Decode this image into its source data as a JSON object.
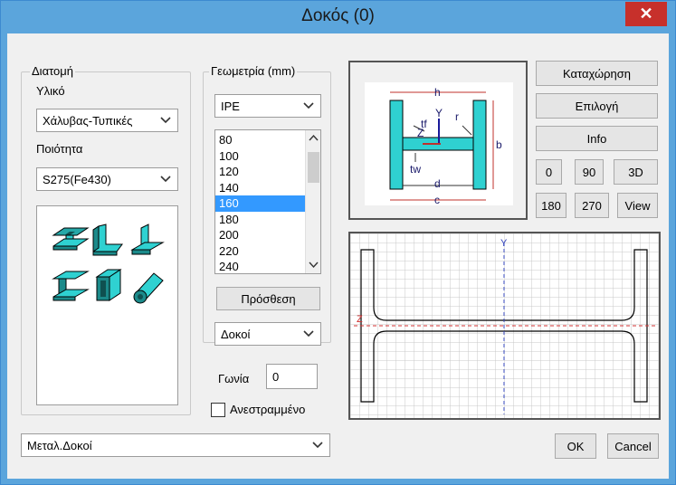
{
  "window": {
    "title": "Δοκός (0)"
  },
  "section": {
    "legend": "Διατομή",
    "material_label": "Υλικό",
    "material_value": "Χάλυβας-Τυπικές",
    "quality_label": "Ποιότητα",
    "quality_value": "S275(Fe430)"
  },
  "geometry": {
    "legend": "Γεωμετρία (mm)",
    "profile_type": "IPE",
    "sizes": [
      "80",
      "100",
      "120",
      "140",
      "160",
      "180",
      "200",
      "220",
      "240"
    ],
    "selected_size": "160",
    "add_button": "Πρόσθεση",
    "category": "Δοκοί"
  },
  "angle": {
    "label": "Γωνία",
    "value": "0"
  },
  "inverted": {
    "label": "Ανεστραμμένο",
    "checked": false
  },
  "library": {
    "value": "Μεταλ.Δοκοί"
  },
  "buttons": {
    "register": "Καταχώρηση",
    "select": "Επιλογή",
    "info": "Info",
    "rot0": "0",
    "rot90": "90",
    "view3d": "3D",
    "rot180": "180",
    "rot270": "270",
    "view": "View",
    "ok": "OK",
    "cancel": "Cancel"
  },
  "diagram": {
    "labels": {
      "h": "h",
      "tf": "tf",
      "z": "Z",
      "y": "Y",
      "r": "r",
      "b": "b",
      "tw": "tw",
      "d": "d",
      "c": "c"
    }
  },
  "preview": {
    "y_axis": "Y",
    "z_axis": "Z"
  },
  "colors": {
    "accent": "#3399ff",
    "titlebar": "#5ba5dc",
    "close": "#c7302b",
    "steel": "#2fd1d1"
  },
  "icons": [
    "i-beam-icon",
    "angle-icon",
    "tee-icon",
    "channel-icon",
    "box-section-icon",
    "pipe-icon"
  ]
}
